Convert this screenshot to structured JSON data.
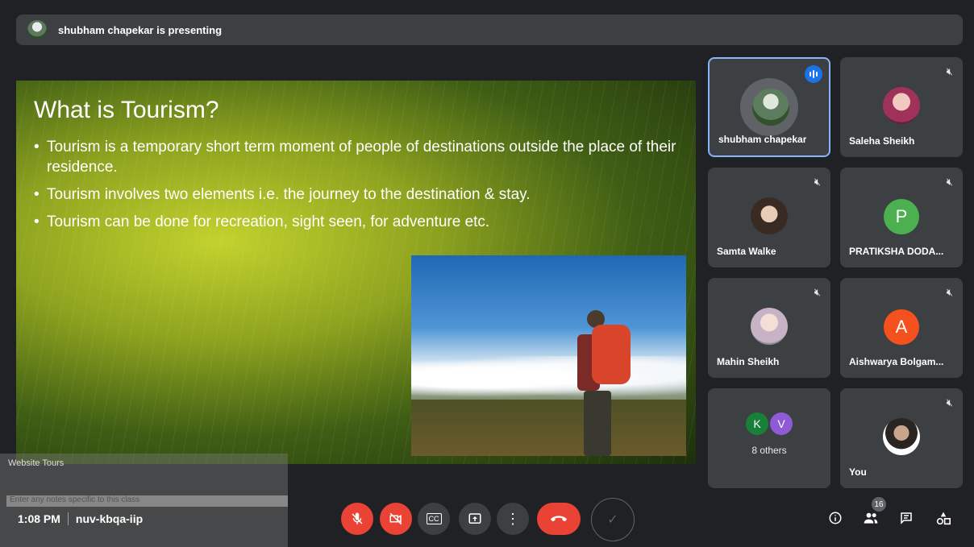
{
  "presenting_bar": {
    "text": "shubham chapekar is presenting"
  },
  "slide": {
    "title": "What is Tourism?",
    "bullets": [
      "Tourism is a temporary short term moment of people of destinations outside the place of their residence.",
      "Tourism involves two elements i.e. the journey to the destination & stay.",
      "Tourism can be done for recreation, sight seen, for adventure etc."
    ]
  },
  "participants": [
    {
      "name": "shubham chapekar",
      "active_speaker": true
    },
    {
      "name": "Saleha Sheikh"
    },
    {
      "name": "Samta Walke"
    },
    {
      "name": "PRATIKSHA DODA...",
      "initial": "P",
      "color": "#4caf50"
    },
    {
      "name": "Mahin Sheikh"
    },
    {
      "name": "Aishwarya Bolgam...",
      "initial": "A",
      "color": "#f4511e"
    },
    {
      "others_label": "8 others",
      "initials": [
        "K",
        "V"
      ],
      "colors": [
        "#188038",
        "#8e5ad6"
      ]
    },
    {
      "name": "You"
    }
  ],
  "notes_overlay": {
    "title": "Website Tours",
    "placeholder": "Enter any notes specific to this class"
  },
  "meeting": {
    "time": "1:08 PM",
    "code": "nuv-kbqa-iip"
  },
  "controls": {
    "mic": "mic-off-icon",
    "camera": "camera-off-icon",
    "captions": "CC",
    "present": "present-icon",
    "more": "more-icon",
    "hangup": "hangup-icon"
  },
  "right_controls": {
    "people_count": "16"
  },
  "colors": {
    "accent_blue": "#8ab4f8",
    "danger_red": "#ea4335",
    "bg": "#202124",
    "tile": "#3c4043"
  }
}
